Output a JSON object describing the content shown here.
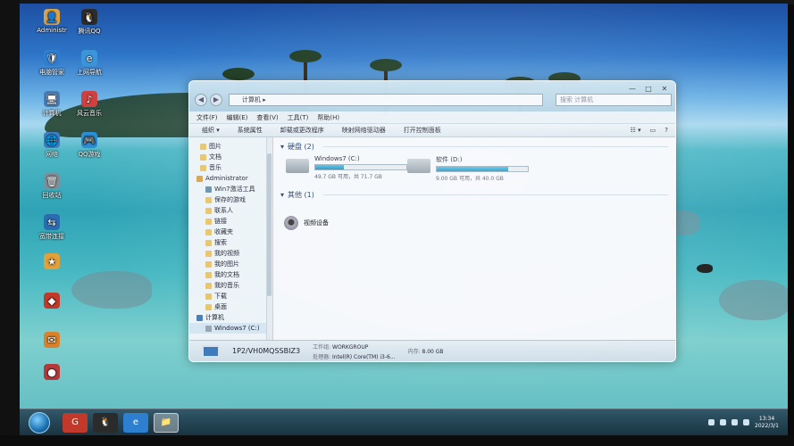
{
  "desktop_icons": [
    {
      "label": "Administr",
      "glyph": "👤",
      "color": "#d8a24a"
    },
    {
      "label": "腾讯QQ",
      "glyph": "🐧",
      "color": "#2c2c2c"
    },
    {
      "label": "电脑管家",
      "glyph": "🛡",
      "color": "#2f7fd0"
    },
    {
      "label": "上网导航",
      "glyph": "e",
      "color": "#3a96d8"
    },
    {
      "label": "计算机",
      "glyph": "🖥",
      "color": "#4a7fb8"
    },
    {
      "label": "风云音乐",
      "glyph": "♪",
      "color": "#d04040"
    },
    {
      "label": "网络",
      "glyph": "🌐",
      "color": "#3b7fc4"
    },
    {
      "label": "QQ游戏",
      "glyph": "🎮",
      "color": "#2a8fd6"
    },
    {
      "label": "回收站",
      "glyph": "🗑",
      "color": "#7f8f99"
    },
    {
      "label": "宽带连接",
      "glyph": "⇆",
      "color": "#2b6cb0"
    },
    {
      "label": "",
      "glyph": "★",
      "color": "#e2a03a"
    },
    {
      "label": "",
      "glyph": "◆",
      "color": "#c0392b"
    },
    {
      "label": "",
      "glyph": "✉",
      "color": "#d9822b"
    },
    {
      "label": "",
      "glyph": "●",
      "color": "#b23a3a"
    }
  ],
  "window": {
    "address": "计算机 ▸",
    "search_placeholder": "搜索 计算机",
    "caption": {
      "minimize": "—",
      "maximize": "□",
      "close": "✕"
    },
    "menu": [
      "文件(F)",
      "编辑(E)",
      "查看(V)",
      "工具(T)",
      "帮助(H)"
    ],
    "toolbar": [
      "组织 ▾",
      "系统属性",
      "卸载或更改程序",
      "映射网络驱动器",
      "打开控制面板"
    ],
    "nav_items": [
      "图片",
      "文档",
      "音乐",
      "Administrator",
      "Win7激活工具",
      "保存的游戏",
      "联系人",
      "链接",
      "收藏夹",
      "搜索",
      "我的视频",
      "我的图片",
      "我的文档",
      "我的音乐",
      "下载",
      "桌面",
      "计算机",
      "Windows7 (C:)"
    ],
    "groups": {
      "hard_disk": "硬盘 (2)",
      "other": "其他 (1)"
    },
    "drives": [
      {
        "name": "Windows7 (C:)",
        "free": "49.7 GB 可用，共 71.7 GB",
        "used_fraction": 0.31
      },
      {
        "name": "软件 (D:)",
        "free": "9.00 GB 可用，共 40.0 GB",
        "used_fraction": 0.78
      }
    ],
    "other_item": "视频设备",
    "details": {
      "computer_name": "1P2/VH0MQSSBIZ3",
      "workgroup_label": "工作组:",
      "workgroup": "WORKGROUP",
      "memory_label": "内存:",
      "memory": "8.00 GB",
      "processor_label": "处理器:",
      "processor": "Intel(R) Core(TM) i3-6..."
    }
  },
  "taskbar": {
    "items": [
      "G",
      "🐧",
      "e",
      "📁"
    ],
    "clock_time": "13:34",
    "clock_date": "2022/3/1"
  }
}
